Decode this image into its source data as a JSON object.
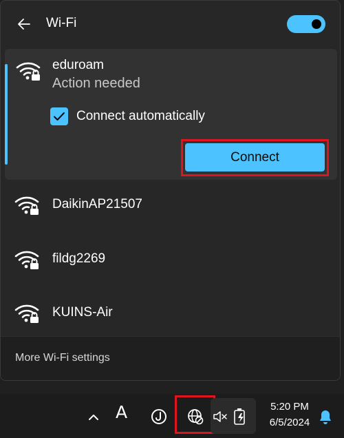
{
  "header": {
    "title": "Wi-Fi",
    "wifi_enabled": true
  },
  "expanded_network": {
    "ssid": "eduroam",
    "status": "Action needed",
    "connect_automatically_label": "Connect automatically",
    "connect_automatically_checked": true,
    "connect_label": "Connect"
  },
  "networks": [
    {
      "ssid": "DaikinAP21507",
      "icon": "wifi-lock-icon"
    },
    {
      "ssid": "fildg2269",
      "icon": "wifi-lock-icon"
    },
    {
      "ssid": "KUINS-Air",
      "icon": "wifi-lock-icon"
    }
  ],
  "footer": {
    "settings_link": "More Wi-Fi settings"
  },
  "taskbar": {
    "ime_label": "A",
    "time": "5:20 PM",
    "date": "6/5/2024",
    "icons": [
      "chevron-up-icon",
      "clock-icon",
      "globe-no-internet-icon",
      "volume-muted-icon",
      "battery-charging-icon",
      "bell-icon"
    ]
  },
  "colors": {
    "accent": "#4cc2ff",
    "highlight": "#e0141e",
    "panel": "#272727"
  }
}
